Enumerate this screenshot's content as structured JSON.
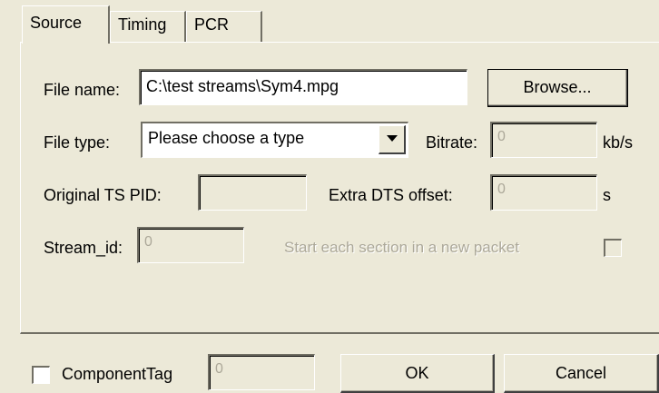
{
  "tabs": [
    {
      "label": "Source",
      "active": true
    },
    {
      "label": "Timing",
      "active": false
    },
    {
      "label": "PCR",
      "active": false
    }
  ],
  "source": {
    "file_name_label": "File name:",
    "file_name_value": "C:\\test streams\\Sym4.mpg",
    "browse_label": "Browse...",
    "file_type_label": "File type:",
    "file_type_value": "Please choose a type",
    "bitrate_label": "Bitrate:",
    "bitrate_value": "0",
    "bitrate_unit": "kb/s",
    "original_ts_pid_label": "Original TS PID:",
    "original_ts_pid_value": "",
    "extra_dts_offset_label": "Extra DTS offset:",
    "extra_dts_offset_value": "0",
    "extra_dts_offset_unit": "s",
    "stream_id_label": "Stream_id:",
    "stream_id_value": "0",
    "new_packet_label": "Start each section in a new packet",
    "new_packet_checked": false
  },
  "footer": {
    "component_tag_label": "ComponentTag",
    "component_tag_checked": false,
    "component_tag_value": "0",
    "ok_label": "OK",
    "cancel_label": "Cancel"
  },
  "colors": {
    "dialog_bg": "#ece9d8",
    "disabled_text": "#aca899",
    "shadow": "#716f64"
  }
}
